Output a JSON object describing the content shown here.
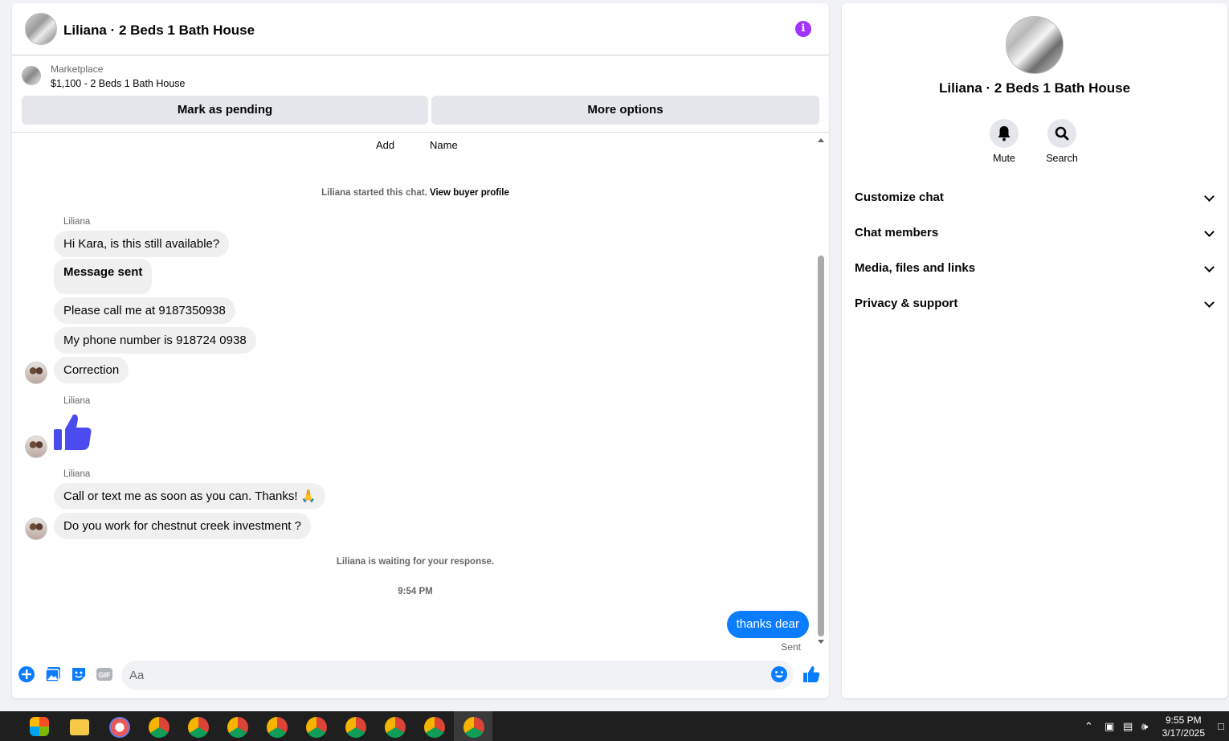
{
  "header": {
    "title": "Liliana · 2 Beds 1 Bath House"
  },
  "listing": {
    "label": "Marketplace",
    "price_line": "$1,100 - 2 Beds 1 Bath House",
    "mark_pending_label": "Mark as pending",
    "more_options_label": "More options"
  },
  "thread": {
    "top_add": "Add",
    "top_name": "Name",
    "started_text": "Liliana started this chat.",
    "view_profile_link": "View buyer profile",
    "messages": [
      {
        "sender": "Liliana",
        "text": "Hi Kara, is this still available?"
      },
      {
        "text": "Message sent"
      },
      {
        "text": "Please call me at 9187350938"
      },
      {
        "text": "My phone number is 918724 0938"
      },
      {
        "text": "Correction"
      },
      {
        "sender": "Liliana",
        "type": "like"
      },
      {
        "sender": "Liliana",
        "text": "Call or text me as soon as you can. Thanks! 🙏"
      },
      {
        "text": "Do you work for chestnut creek investment ?"
      }
    ],
    "waiting_text": "Liliana is waiting for your response.",
    "timestamp": "9:54 PM",
    "outgoing": {
      "text": "thanks dear",
      "status": "Sent"
    }
  },
  "composer": {
    "placeholder": "Aa"
  },
  "side": {
    "title": "Liliana · 2 Beds 1 Bath House",
    "mute_label": "Mute",
    "search_label": "Search",
    "sections": [
      "Customize chat",
      "Chat members",
      "Media, files and links",
      "Privacy & support"
    ]
  },
  "taskbar": {
    "time": "9:55 PM",
    "date": "3/17/2025"
  },
  "colors": {
    "accent": "#0a7cff",
    "info": "#a033ff",
    "like": "#4b4bf0"
  }
}
